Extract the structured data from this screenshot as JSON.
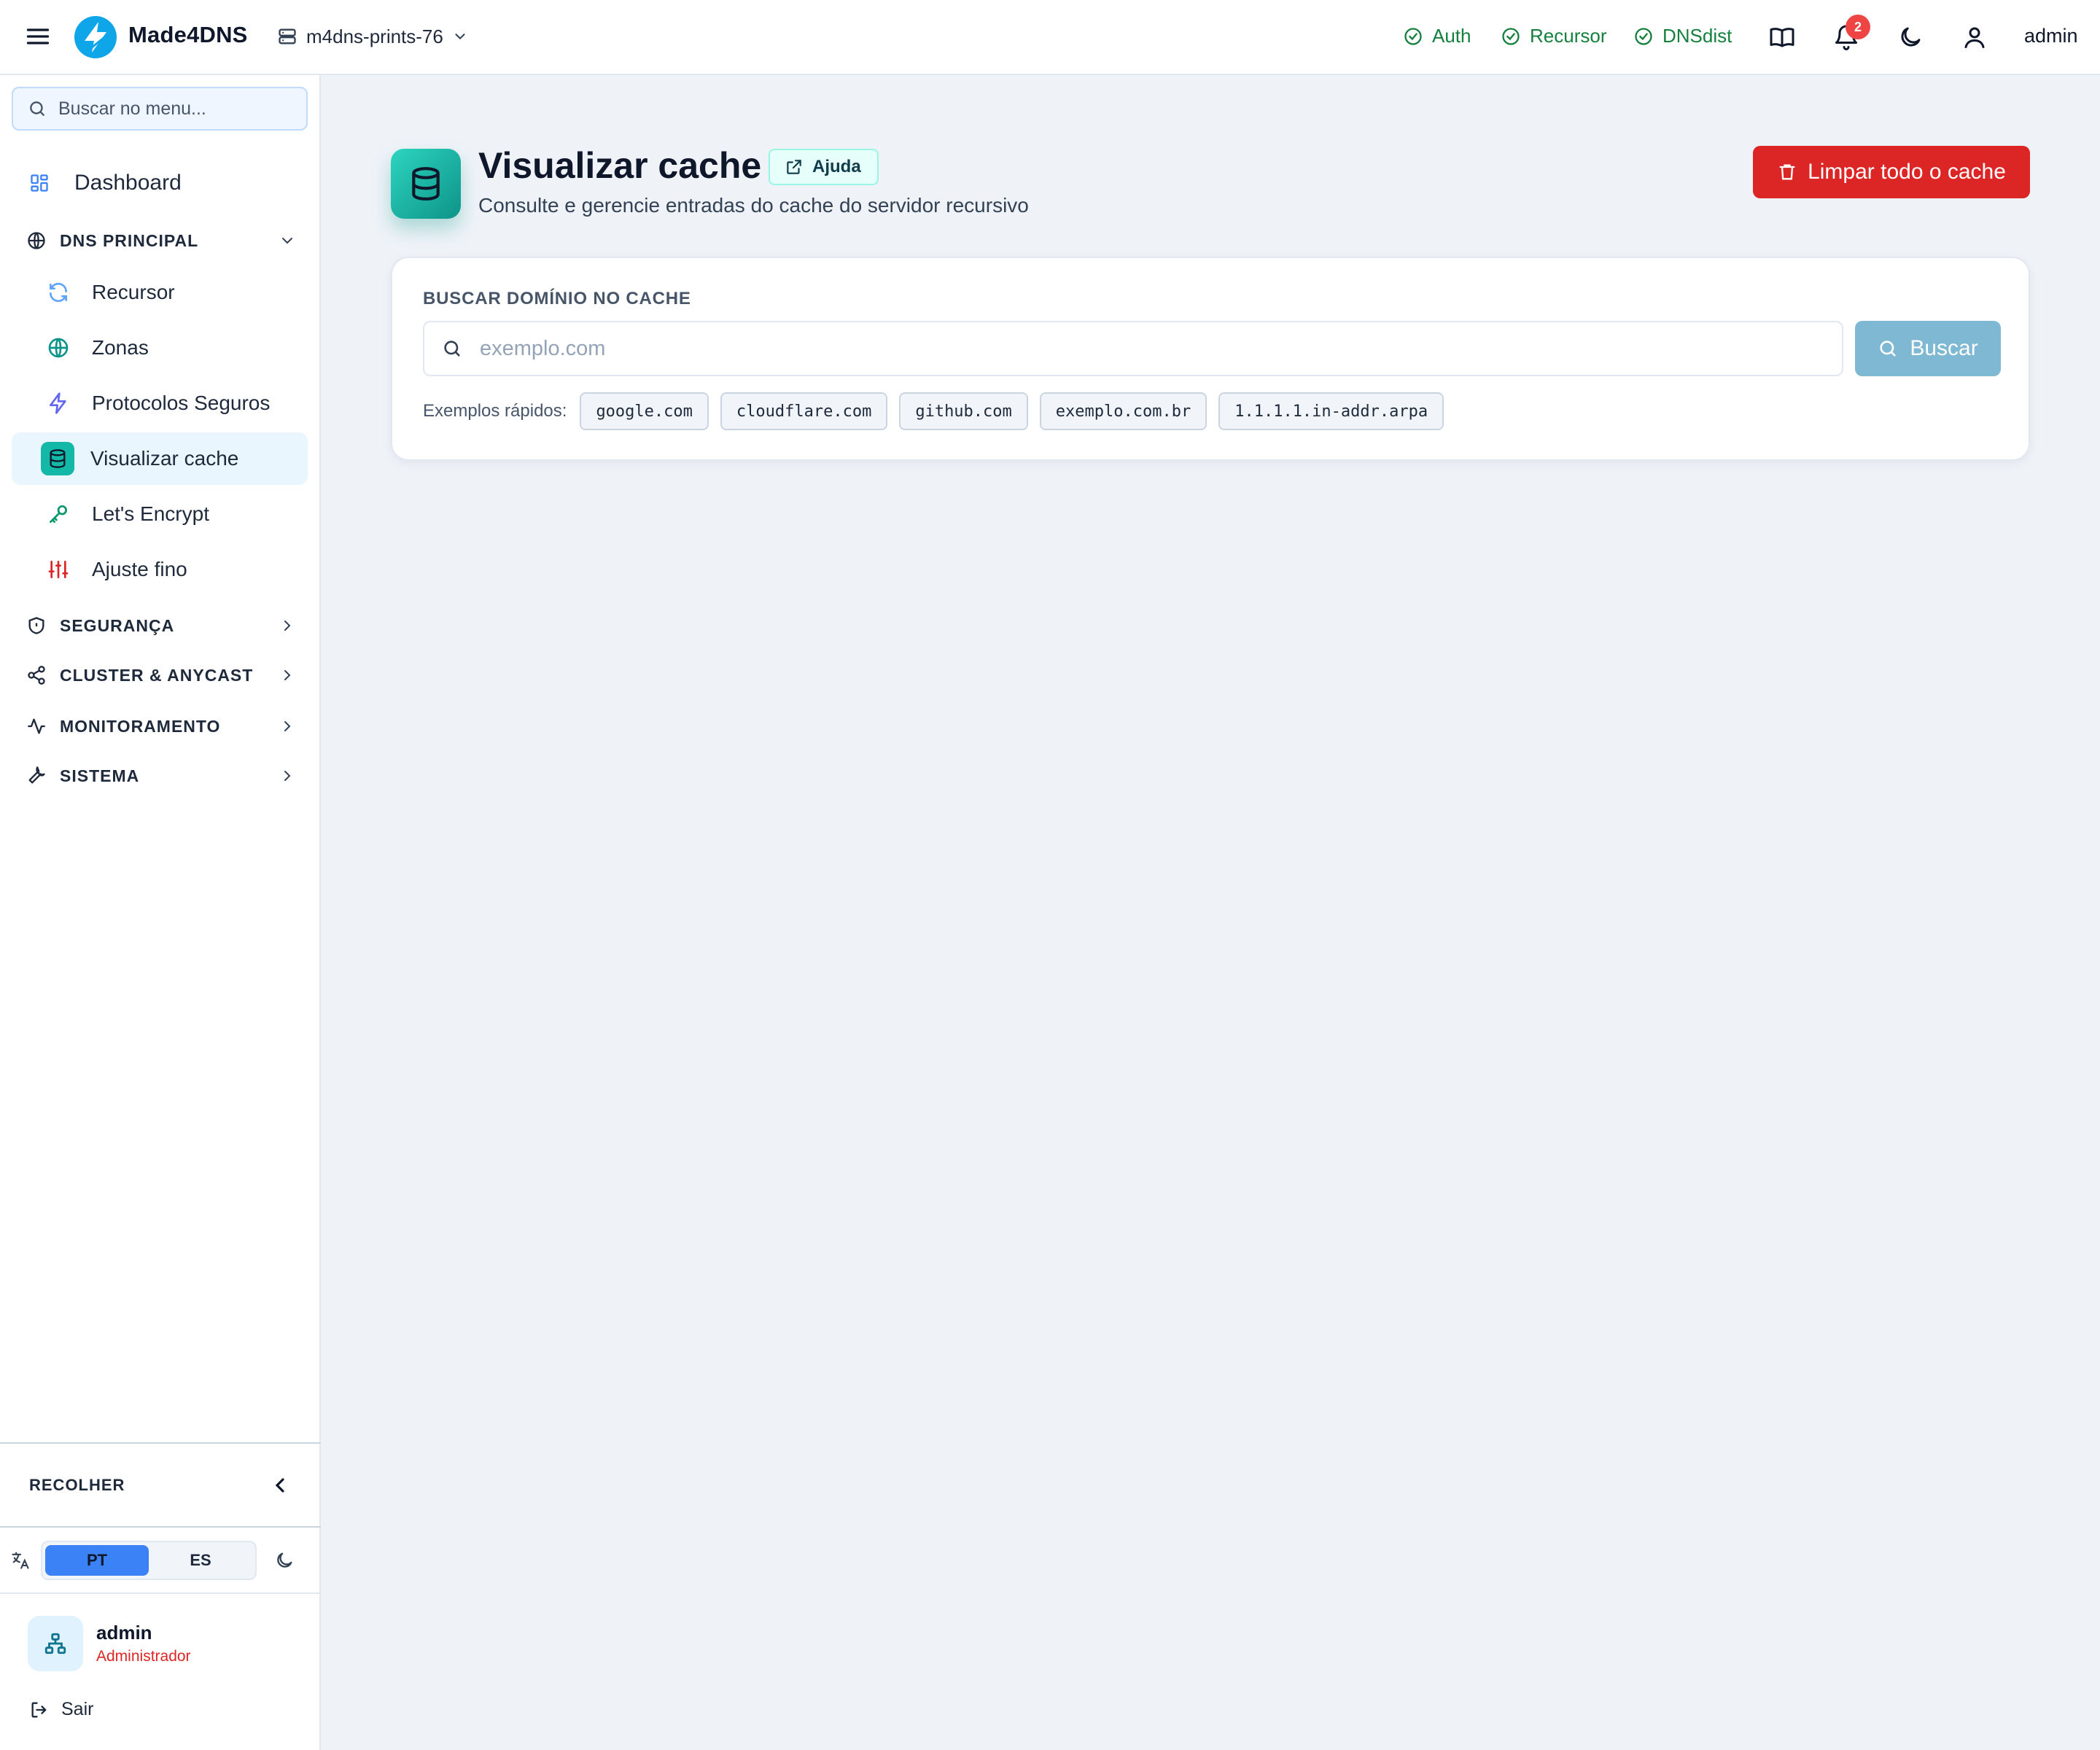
{
  "topbar": {
    "brand": "Made4DNS",
    "server": "m4dns-prints-76",
    "services": [
      {
        "label": "Auth",
        "state": "ok"
      },
      {
        "label": "Recursor",
        "state": "ok"
      },
      {
        "label": "DNSdist",
        "state": "ok"
      }
    ],
    "notification_count": "2",
    "user": "admin",
    "colors": {
      "service_ok": "#15803d",
      "badge": "#ef4444",
      "logo": "#0ea5e9"
    }
  },
  "sidebar": {
    "search_placeholder": "Buscar no menu...",
    "dashboard": "Dashboard",
    "sections": {
      "dns_principal": "DNS PRINCIPAL",
      "seguranca": "SEGURANÇA",
      "cluster": "CLUSTER & ANYCAST",
      "monitoramento": "MONITORAMENTO",
      "sistema": "SISTEMA"
    },
    "dns_items": [
      {
        "label": "Recursor",
        "icon": "refresh-icon",
        "color": "#60a5fa"
      },
      {
        "label": "Zonas",
        "icon": "globe-icon",
        "color": "#0d9488"
      },
      {
        "label": "Protocolos Seguros",
        "icon": "bolt-icon",
        "color": "#6366f1"
      },
      {
        "label": "Visualizar cache",
        "icon": "database-icon",
        "active": true
      },
      {
        "label": "Let's Encrypt",
        "icon": "key-icon",
        "color": "#059669"
      },
      {
        "label": "Ajuste fino",
        "icon": "sliders-icon",
        "color": "#dc2626"
      }
    ],
    "collapse": "RECOLHER",
    "languages": [
      "PT",
      "ES"
    ],
    "active_language": "PT",
    "profile": {
      "name": "admin",
      "role": "Administrador"
    },
    "logout": "Sair"
  },
  "main": {
    "title": "Visualizar cache",
    "help": "Ajuda",
    "subtitle": "Consulte e gerencie entradas do cache do servidor recursivo",
    "clear_button": "Limpar todo o cache",
    "search": {
      "label": "BUSCAR DOMÍNIO NO CACHE",
      "placeholder": "exemplo.com",
      "value": "",
      "button": "Buscar"
    },
    "examples_label": "Exemplos rápidos:",
    "examples": [
      "google.com",
      "cloudflare.com",
      "github.com",
      "exemplo.com.br",
      "1.1.1.1.in-addr.arpa"
    ],
    "colors": {
      "accent": "#14b8a6",
      "danger": "#dc2626",
      "search_button": "#7fb8d3"
    }
  }
}
